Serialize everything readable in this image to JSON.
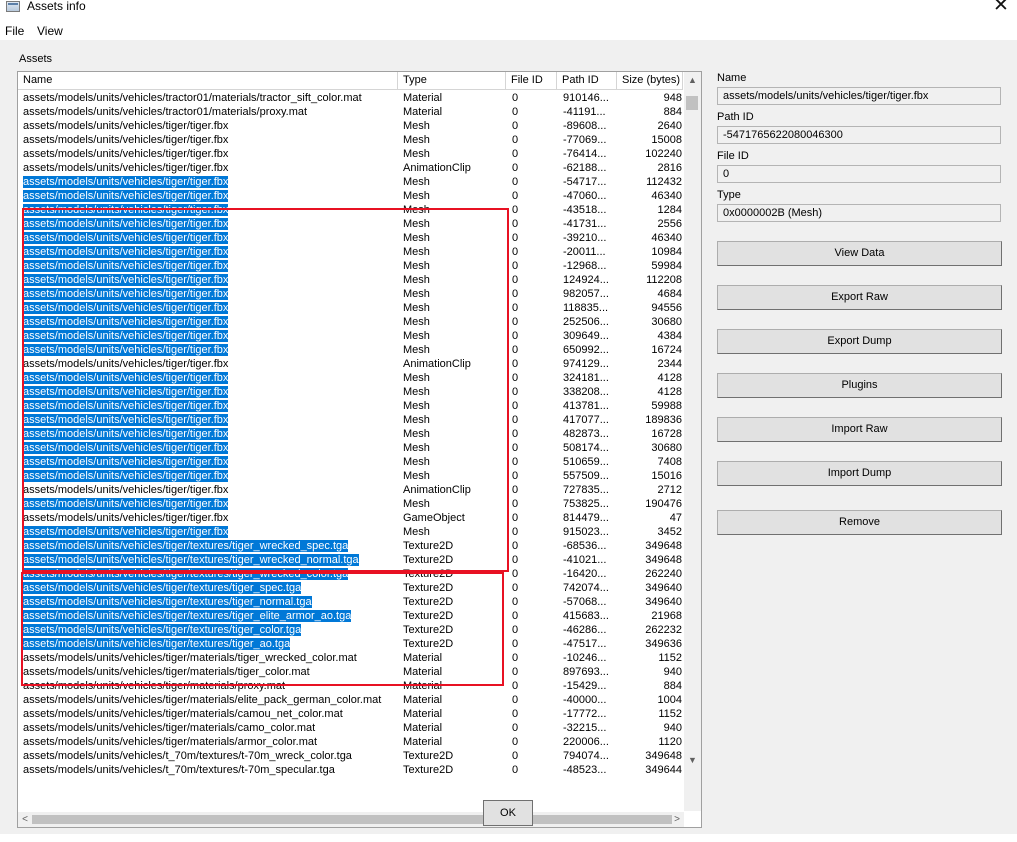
{
  "window": {
    "title": "Assets info",
    "close_glyph": "✕"
  },
  "menu": [
    "File",
    "View"
  ],
  "group_title": "Assets",
  "columns": [
    "Name",
    "Type",
    "File ID",
    "Path ID",
    "Size (bytes)"
  ],
  "selection_color": "#0078d7",
  "annotation_color": "#e81123",
  "rows": [
    {
      "name": "assets/models/units/vehicles/tractor01/materials/tractor_sift_color.mat",
      "type": "Material",
      "file_id": "0",
      "path_id": "910146...",
      "size": "948",
      "selected": false
    },
    {
      "name": "assets/models/units/vehicles/tractor01/materials/proxy.mat",
      "type": "Material",
      "file_id": "0",
      "path_id": "-41191...",
      "size": "884",
      "selected": false
    },
    {
      "name": "assets/models/units/vehicles/tiger/tiger.fbx",
      "type": "Mesh",
      "file_id": "0",
      "path_id": "-89608...",
      "size": "2640",
      "selected": false
    },
    {
      "name": "assets/models/units/vehicles/tiger/tiger.fbx",
      "type": "Mesh",
      "file_id": "0",
      "path_id": "-77069...",
      "size": "15008",
      "selected": false
    },
    {
      "name": "assets/models/units/vehicles/tiger/tiger.fbx",
      "type": "Mesh",
      "file_id": "0",
      "path_id": "-76414...",
      "size": "102240",
      "selected": false
    },
    {
      "name": "assets/models/units/vehicles/tiger/tiger.fbx",
      "type": "AnimationClip",
      "file_id": "0",
      "path_id": "-62188...",
      "size": "2816",
      "selected": false
    },
    {
      "name": "assets/models/units/vehicles/tiger/tiger.fbx",
      "type": "Mesh",
      "file_id": "0",
      "path_id": "-54717...",
      "size": "112432",
      "selected": true
    },
    {
      "name": "assets/models/units/vehicles/tiger/tiger.fbx",
      "type": "Mesh",
      "file_id": "0",
      "path_id": "-47060...",
      "size": "46340",
      "selected": true
    },
    {
      "name": "assets/models/units/vehicles/tiger/tiger.fbx",
      "type": "Mesh",
      "file_id": "0",
      "path_id": "-43518...",
      "size": "1284",
      "selected": true
    },
    {
      "name": "assets/models/units/vehicles/tiger/tiger.fbx",
      "type": "Mesh",
      "file_id": "0",
      "path_id": "-41731...",
      "size": "2556",
      "selected": true
    },
    {
      "name": "assets/models/units/vehicles/tiger/tiger.fbx",
      "type": "Mesh",
      "file_id": "0",
      "path_id": "-39210...",
      "size": "46340",
      "selected": true
    },
    {
      "name": "assets/models/units/vehicles/tiger/tiger.fbx",
      "type": "Mesh",
      "file_id": "0",
      "path_id": "-20011...",
      "size": "10984",
      "selected": true
    },
    {
      "name": "assets/models/units/vehicles/tiger/tiger.fbx",
      "type": "Mesh",
      "file_id": "0",
      "path_id": "-12968...",
      "size": "59984",
      "selected": true
    },
    {
      "name": "assets/models/units/vehicles/tiger/tiger.fbx",
      "type": "Mesh",
      "file_id": "0",
      "path_id": "124924...",
      "size": "112208",
      "selected": true
    },
    {
      "name": "assets/models/units/vehicles/tiger/tiger.fbx",
      "type": "Mesh",
      "file_id": "0",
      "path_id": "982057...",
      "size": "4684",
      "selected": true
    },
    {
      "name": "assets/models/units/vehicles/tiger/tiger.fbx",
      "type": "Mesh",
      "file_id": "0",
      "path_id": "118835...",
      "size": "94556",
      "selected": true
    },
    {
      "name": "assets/models/units/vehicles/tiger/tiger.fbx",
      "type": "Mesh",
      "file_id": "0",
      "path_id": "252506...",
      "size": "30680",
      "selected": true
    },
    {
      "name": "assets/models/units/vehicles/tiger/tiger.fbx",
      "type": "Mesh",
      "file_id": "0",
      "path_id": "309649...",
      "size": "4384",
      "selected": true
    },
    {
      "name": "assets/models/units/vehicles/tiger/tiger.fbx",
      "type": "Mesh",
      "file_id": "0",
      "path_id": "650992...",
      "size": "16724",
      "selected": true
    },
    {
      "name": "assets/models/units/vehicles/tiger/tiger.fbx",
      "type": "AnimationClip",
      "file_id": "0",
      "path_id": "974129...",
      "size": "2344",
      "selected": false
    },
    {
      "name": "assets/models/units/vehicles/tiger/tiger.fbx",
      "type": "Mesh",
      "file_id": "0",
      "path_id": "324181...",
      "size": "4128",
      "selected": true
    },
    {
      "name": "assets/models/units/vehicles/tiger/tiger.fbx",
      "type": "Mesh",
      "file_id": "0",
      "path_id": "338208...",
      "size": "4128",
      "selected": true
    },
    {
      "name": "assets/models/units/vehicles/tiger/tiger.fbx",
      "type": "Mesh",
      "file_id": "0",
      "path_id": "413781...",
      "size": "59988",
      "selected": true
    },
    {
      "name": "assets/models/units/vehicles/tiger/tiger.fbx",
      "type": "Mesh",
      "file_id": "0",
      "path_id": "417077...",
      "size": "189836",
      "selected": true
    },
    {
      "name": "assets/models/units/vehicles/tiger/tiger.fbx",
      "type": "Mesh",
      "file_id": "0",
      "path_id": "482873...",
      "size": "16728",
      "selected": true
    },
    {
      "name": "assets/models/units/vehicles/tiger/tiger.fbx",
      "type": "Mesh",
      "file_id": "0",
      "path_id": "508174...",
      "size": "30680",
      "selected": true
    },
    {
      "name": "assets/models/units/vehicles/tiger/tiger.fbx",
      "type": "Mesh",
      "file_id": "0",
      "path_id": "510659...",
      "size": "7408",
      "selected": true
    },
    {
      "name": "assets/models/units/vehicles/tiger/tiger.fbx",
      "type": "Mesh",
      "file_id": "0",
      "path_id": "557509...",
      "size": "15016",
      "selected": true
    },
    {
      "name": "assets/models/units/vehicles/tiger/tiger.fbx",
      "type": "AnimationClip",
      "file_id": "0",
      "path_id": "727835...",
      "size": "2712",
      "selected": false
    },
    {
      "name": "assets/models/units/vehicles/tiger/tiger.fbx",
      "type": "Mesh",
      "file_id": "0",
      "path_id": "753825...",
      "size": "190476",
      "selected": true
    },
    {
      "name": "assets/models/units/vehicles/tiger/tiger.fbx",
      "type": "GameObject",
      "file_id": "0",
      "path_id": "814479...",
      "size": "47",
      "selected": false
    },
    {
      "name": "assets/models/units/vehicles/tiger/tiger.fbx",
      "type": "Mesh",
      "file_id": "0",
      "path_id": "915023...",
      "size": "3452",
      "selected": true
    },
    {
      "name": "assets/models/units/vehicles/tiger/textures/tiger_wrecked_spec.tga",
      "type": "Texture2D",
      "file_id": "0",
      "path_id": "-68536...",
      "size": "349648",
      "selected": true
    },
    {
      "name": "assets/models/units/vehicles/tiger/textures/tiger_wrecked_normal.tga",
      "type": "Texture2D",
      "file_id": "0",
      "path_id": "-41021...",
      "size": "349648",
      "selected": true
    },
    {
      "name": "assets/models/units/vehicles/tiger/textures/tiger_wrecked_color.tga",
      "type": "Texture2D",
      "file_id": "0",
      "path_id": "-16420...",
      "size": "262240",
      "selected": true
    },
    {
      "name": "assets/models/units/vehicles/tiger/textures/tiger_spec.tga",
      "type": "Texture2D",
      "file_id": "0",
      "path_id": "742074...",
      "size": "349640",
      "selected": true
    },
    {
      "name": "assets/models/units/vehicles/tiger/textures/tiger_normal.tga",
      "type": "Texture2D",
      "file_id": "0",
      "path_id": "-57068...",
      "size": "349640",
      "selected": true
    },
    {
      "name": "assets/models/units/vehicles/tiger/textures/tiger_elite_armor_ao.tga",
      "type": "Texture2D",
      "file_id": "0",
      "path_id": "415683...",
      "size": "21968",
      "selected": true
    },
    {
      "name": "assets/models/units/vehicles/tiger/textures/tiger_color.tga",
      "type": "Texture2D",
      "file_id": "0",
      "path_id": "-46286...",
      "size": "262232",
      "selected": true
    },
    {
      "name": "assets/models/units/vehicles/tiger/textures/tiger_ao.tga",
      "type": "Texture2D",
      "file_id": "0",
      "path_id": "-47517...",
      "size": "349636",
      "selected": true
    },
    {
      "name": "assets/models/units/vehicles/tiger/materials/tiger_wrecked_color.mat",
      "type": "Material",
      "file_id": "0",
      "path_id": "-10246...",
      "size": "1152",
      "selected": false
    },
    {
      "name": "assets/models/units/vehicles/tiger/materials/tiger_color.mat",
      "type": "Material",
      "file_id": "0",
      "path_id": "897693...",
      "size": "940",
      "selected": false
    },
    {
      "name": "assets/models/units/vehicles/tiger/materials/proxy.mat",
      "type": "Material",
      "file_id": "0",
      "path_id": "-15429...",
      "size": "884",
      "selected": false
    },
    {
      "name": "assets/models/units/vehicles/tiger/materials/elite_pack_german_color.mat",
      "type": "Material",
      "file_id": "0",
      "path_id": "-40000...",
      "size": "1004",
      "selected": false
    },
    {
      "name": "assets/models/units/vehicles/tiger/materials/camou_net_color.mat",
      "type": "Material",
      "file_id": "0",
      "path_id": "-17772...",
      "size": "1152",
      "selected": false
    },
    {
      "name": "assets/models/units/vehicles/tiger/materials/camo_color.mat",
      "type": "Material",
      "file_id": "0",
      "path_id": "-32215...",
      "size": "940",
      "selected": false
    },
    {
      "name": "assets/models/units/vehicles/tiger/materials/armor_color.mat",
      "type": "Material",
      "file_id": "0",
      "path_id": "220006...",
      "size": "1120",
      "selected": false
    },
    {
      "name": "assets/models/units/vehicles/t_70m/textures/t-70m_wreck_color.tga",
      "type": "Texture2D",
      "file_id": "0",
      "path_id": "794074...",
      "size": "349648",
      "selected": false
    },
    {
      "name": "assets/models/units/vehicles/t_70m/textures/t-70m_specular.tga",
      "type": "Texture2D",
      "file_id": "0",
      "path_id": "-48523...",
      "size": "349644",
      "selected": false
    }
  ],
  "details": {
    "name_label": "Name",
    "name_value": "assets/models/units/vehicles/tiger/tiger.fbx",
    "path_id_label": "Path ID",
    "path_id_value": "-5471765622080046300",
    "file_id_label": "File ID",
    "file_id_value": "0",
    "type_label": "Type",
    "type_value": "0x0000002B (Mesh)"
  },
  "actions": {
    "view_data": "View Data",
    "export_raw": "Export Raw",
    "export_dump": "Export Dump",
    "plugins": "Plugins",
    "import_raw": "Import Raw",
    "import_dump": "Import Dump",
    "remove": "Remove"
  },
  "ok_label": "OK",
  "scroll": {
    "up_icon": "▲",
    "down_icon": "▼",
    "left_icon": "<",
    "right_icon": ">"
  }
}
